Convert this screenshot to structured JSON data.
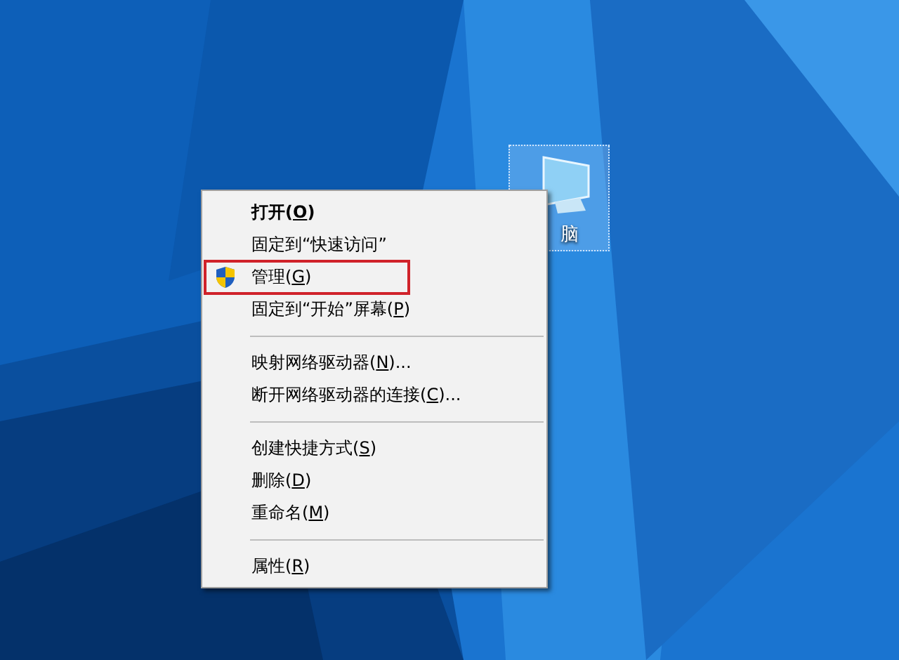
{
  "desktop_icon": {
    "label": "脑",
    "selected": true
  },
  "context_menu": {
    "groups": [
      {
        "items": [
          {
            "before": "打开(",
            "accel": "O",
            "after": ")",
            "default": true,
            "highlighted": false
          },
          {
            "before": "固定到“快速访问”",
            "default": false,
            "highlighted": false
          },
          {
            "before": "管理(",
            "accel": "G",
            "after": ")",
            "kind": "shielded",
            "default": false,
            "highlighted": true
          },
          {
            "before": "固定到“开始”屏幕(",
            "accel": "P",
            "after": ")",
            "default": false,
            "highlighted": false
          }
        ]
      },
      {
        "items": [
          {
            "before": "映射网络驱动器(",
            "accel": "N",
            "after": ")...",
            "default": false,
            "highlighted": false
          },
          {
            "before": "断开网络驱动器的连接(",
            "accel": "C",
            "after": ")...",
            "default": false,
            "highlighted": false
          }
        ]
      },
      {
        "items": [
          {
            "before": "创建快捷方式(",
            "accel": "S",
            "after": ")",
            "default": false,
            "highlighted": false
          },
          {
            "before": "删除(",
            "accel": "D",
            "after": ")",
            "default": false,
            "highlighted": false
          },
          {
            "before": "重命名(",
            "accel": "M",
            "after": ")",
            "default": false,
            "highlighted": false
          }
        ]
      },
      {
        "items": [
          {
            "before": "属性(",
            "accel": "R",
            "after": ")",
            "default": false,
            "highlighted": false
          }
        ]
      }
    ]
  }
}
